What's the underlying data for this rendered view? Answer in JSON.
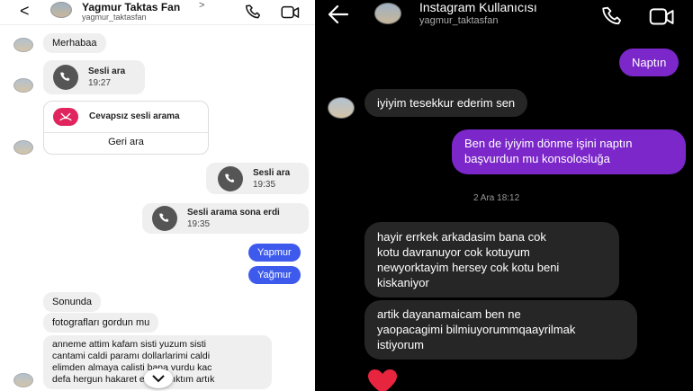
{
  "left": {
    "header": {
      "name": "Yagmur Taktas Fan",
      "chevron": ">",
      "username": "yagmur_taktasfan",
      "back": "<"
    },
    "messages": {
      "greeting": "Merhabaa",
      "call1_title": "Sesli ara",
      "call1_time": "19:27",
      "missed_title": "Cevapsız sesli arama",
      "callback_label": "Geri ara",
      "call2_title": "Sesli ara",
      "call2_time": "19:35",
      "ended_title": "Sesli arama sona erdi",
      "ended_time": "19:35",
      "out1": "Yapmur",
      "out2": "Yağmur",
      "in1": "Sonunda",
      "in2": "fotografları gordun mu",
      "in3_line1": "anneme attim kafam sisti yuzum sisti",
      "in3_line2": "cantami caldi paramı dollarlarimi caldi",
      "in3_line3": "elimden almaya calisti bana vurdu kac",
      "in3_line4": "defa hergun hakaret ediyor bıktım artık"
    },
    "colors": {
      "outgoing": "#3d5aed",
      "incoming": "#efefef",
      "missed": "#e0245e"
    }
  },
  "right": {
    "header": {
      "name": "Instagram Kullanıcısı",
      "username": "yagmur_taktasfan"
    },
    "messages": {
      "out1": "Naptın",
      "in1": "iyiyim tesekkur ederim sen",
      "out2_line1": "Ben de iyiyim dönme işini naptın",
      "out2_line2": "başvurdun mu konsolosluğa",
      "date": "2 Ara 18:12",
      "in2_line1": "hayir errkek arkadasim bana cok",
      "in2_line2": "kotu davranuyor cok kotuyum",
      "in2_line3": "newyorktayim hersey cok kotu beni",
      "in2_line4": "kiskaniyor",
      "in3_line1": "artik dayanamaicam ben ne",
      "in3_line2": "yaopacagimi bilmiuyorummqaayrilmak",
      "in3_line3": "istiyorum",
      "reaction": "❤️"
    },
    "colors": {
      "outgoing": "#7b27c9",
      "incoming": "#262626",
      "heart": "#e8253f"
    }
  }
}
